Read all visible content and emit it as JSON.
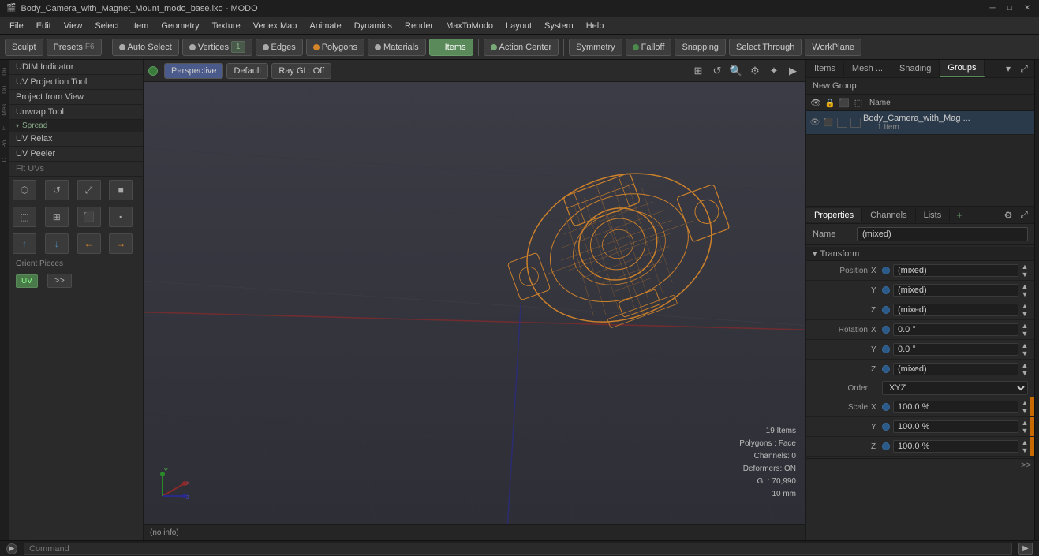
{
  "window": {
    "title": "Body_Camera_with_Magnet_Mount_modo_base.lxo - MODO"
  },
  "title_bar": {
    "minimize": "─",
    "maximize": "□",
    "close": "✕"
  },
  "menu_bar": {
    "items": [
      "File",
      "Edit",
      "View",
      "Select",
      "Item",
      "Geometry",
      "Texture",
      "Vertex Map",
      "Animate",
      "Dynamics",
      "Render",
      "MaxToModo",
      "Layout",
      "System",
      "Help"
    ]
  },
  "toolbar": {
    "sculpt_label": "Sculpt",
    "presets_label": "Presets",
    "presets_shortcut": "F6",
    "auto_select": "Auto Select",
    "vertices": "Vertices",
    "vertices_num": "1",
    "edges": "Edges",
    "edges_num": "",
    "polygons": "Polygons",
    "materials": "Materials",
    "items": "Items",
    "action_center": "Action Center",
    "symmetry": "Symmetry",
    "falloff": "Falloff",
    "snapping": "Snapping",
    "select_through": "Select Through",
    "workplane": "WorkPlane"
  },
  "left_panel": {
    "tools": [
      "UDIM Indicator",
      "UV Projection Tool",
      "Project from View",
      "Unwrap Tool"
    ],
    "spread_label": "Spread",
    "uv_relax": "UV Relax",
    "uv_peeler": "UV Peeler",
    "fit_uvs": "Fit UVs",
    "orient_label": "Orient Pieces",
    "uv_badge": "UV",
    "expand_btn": ">>",
    "icon_arrows": [
      "↑",
      "↓",
      "←",
      "→"
    ],
    "icon_tools_row1": [
      "🔧",
      "🔄",
      "↕",
      "⬛"
    ],
    "icon_tools_row2": [
      "⬛",
      "⊞",
      "⬚",
      "⬛"
    ]
  },
  "viewport": {
    "perspective_label": "Perspective",
    "default_label": "Default",
    "ray_gl_label": "Ray GL: Off",
    "status_text": "(no info)",
    "stats": {
      "items": "19 Items",
      "polygons": "Polygons : Face",
      "channels": "Channels: 0",
      "deformers": "Deformers: ON",
      "gl": "GL: 70,990",
      "size": "10 mm"
    }
  },
  "right_panel": {
    "tabs": [
      "Items",
      "Mesh ...",
      "Shading",
      "Groups"
    ],
    "active_tab": "Groups",
    "new_group": "New Group",
    "name_col": "Name",
    "items_list": [
      {
        "name": "Body_Camera_with_Mag ...",
        "sub": "1 Item",
        "selected": true
      }
    ]
  },
  "properties": {
    "tabs": [
      "Properties",
      "Channels",
      "Lists"
    ],
    "add_tab": "+",
    "active_tab": "Properties",
    "name_label": "Name",
    "name_value": "(mixed)",
    "transform_section": "Transform",
    "position": {
      "label": "Position",
      "x": {
        "axis": "X",
        "value": "(mixed)"
      },
      "y": {
        "axis": "Y",
        "value": "(mixed)"
      },
      "z": {
        "axis": "Z",
        "value": "(mixed)"
      }
    },
    "rotation": {
      "label": "Rotation",
      "x": {
        "axis": "X",
        "value": "0.0 °"
      },
      "y": {
        "axis": "Y",
        "value": "0.0 °"
      },
      "z": {
        "axis": "Z",
        "value": "(mixed)"
      }
    },
    "order": {
      "label": "Order",
      "value": "XYZ"
    },
    "scale": {
      "label": "Scale",
      "x": {
        "axis": "X",
        "value": "100.0 %"
      },
      "y": {
        "axis": "Y",
        "value": "100.0 %"
      },
      "z": {
        "axis": "Z",
        "value": "100.0 %"
      }
    }
  },
  "command_bar": {
    "placeholder": "Command",
    "run_btn": "▶"
  },
  "side_strips": {
    "left_labels": [
      "Du...",
      "Du...",
      "Mes...",
      "E...",
      "Po...",
      "C..."
    ],
    "right_label": ""
  }
}
